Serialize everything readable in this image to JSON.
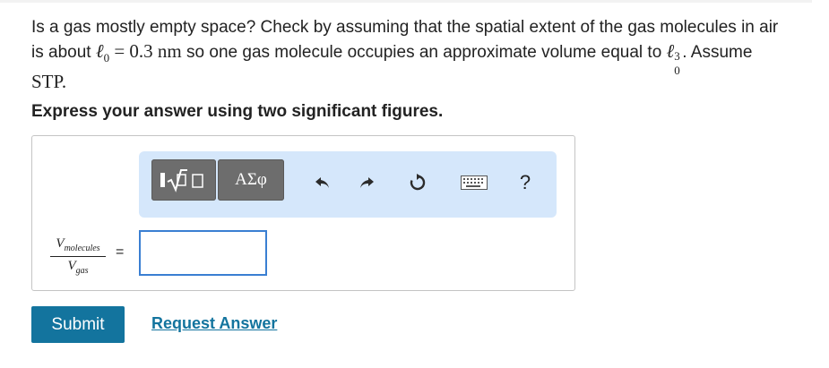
{
  "question": {
    "line1": "Is a gas mostly empty space? Check by assuming that the spatial extent of the gas molecules in air",
    "line2_pre": "is about",
    "symbol_l": "ℓ",
    "subscript_0": "0",
    "equals": "=",
    "value": "0.3",
    "unit": "nm",
    "line2_post": "so one gas molecule occupies an approximate volume equal to",
    "superscript_3": "3",
    "line2_end": ". Assume",
    "line3": "STP."
  },
  "instruction": "Express your answer using two significant figures.",
  "toolbar": {
    "templates_icon": "templates-radical-icon",
    "symbols_label": "ΑΣφ",
    "undo_icon": "undo-icon",
    "redo_icon": "redo-icon",
    "reset_icon": "reset-icon",
    "keyboard_icon": "keyboard-icon",
    "help_label": "?"
  },
  "fraction": {
    "numerator_var": "V",
    "numerator_sub": "molecules",
    "denominator_var": "V",
    "denominator_sub": "gas",
    "equals": "="
  },
  "answer_input": {
    "value": ""
  },
  "buttons": {
    "submit_label": "Submit",
    "request_label": "Request Answer"
  },
  "colors": {
    "toolbar_bg": "#d5e7fb",
    "tool_button_bg": "#6d6d6d",
    "input_border": "#3a7fd2",
    "submit_bg": "#13749e",
    "link": "#13749e"
  }
}
